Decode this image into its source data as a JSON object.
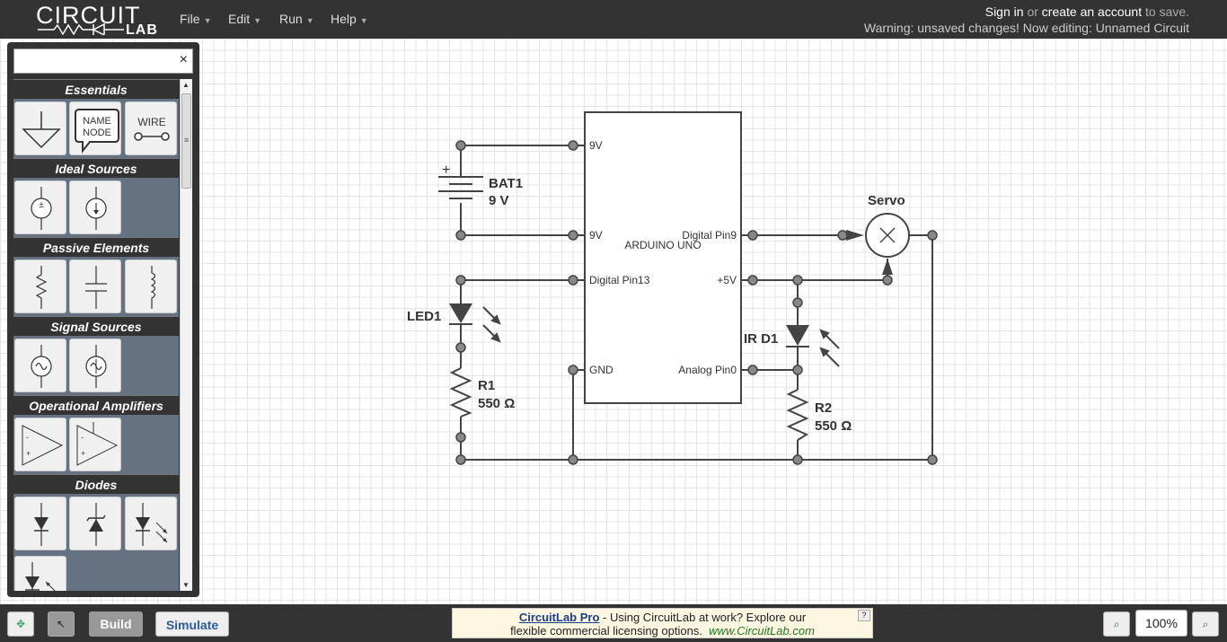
{
  "app": {
    "logo_word": "CIRCUIT",
    "logo_lab": "LAB"
  },
  "menu": [
    {
      "label": "File"
    },
    {
      "label": "Edit"
    },
    {
      "label": "Run"
    },
    {
      "label": "Help"
    }
  ],
  "account": {
    "signin": "Sign in",
    "or": "or",
    "create": "create an account",
    "tosave": "to save."
  },
  "warning": "Warning: unsaved changes! Now editing: Unnamed Circuit",
  "search": {
    "placeholder": "",
    "close": "×"
  },
  "categories": [
    {
      "label": "Essentials"
    },
    {
      "label": "Ideal Sources"
    },
    {
      "label": "Passive Elements"
    },
    {
      "label": "Signal Sources"
    },
    {
      "label": "Operational Amplifiers"
    },
    {
      "label": "Diodes"
    }
  ],
  "tile_text": {
    "name_node_line1": "NAME",
    "name_node_line2": "NODE",
    "wire": "WIRE"
  },
  "schematic": {
    "arduino": "ARDUINO UNO",
    "pins": {
      "left_top": "9V",
      "left_mid": "9V",
      "left_d13": "Digital Pin13",
      "left_gnd": "GND",
      "right_d9": "Digital Pin9",
      "right_5v": "+5V",
      "right_a0": "Analog Pin0"
    },
    "battery": {
      "name": "BAT1",
      "value": "9 V",
      "plus": "+"
    },
    "led": {
      "name": "LED1"
    },
    "r1": {
      "name": "R1",
      "value": "550 Ω"
    },
    "ird": {
      "name": "IR D1"
    },
    "r2": {
      "name": "R2",
      "value": "550 Ω"
    },
    "servo": {
      "name": "Servo"
    }
  },
  "bottom": {
    "build": "Build",
    "simulate": "Simulate",
    "ad_link": "CircuitLab Pro",
    "ad_text1": " - Using CircuitLab at work? Explore our",
    "ad_text2": "flexible commercial licensing options.",
    "ad_url": "www.CircuitLab.com",
    "ad_help": "?",
    "zoom": "100%"
  },
  "colors": {
    "topbar": "#333333",
    "wire": "#444444",
    "node": "#888888"
  }
}
